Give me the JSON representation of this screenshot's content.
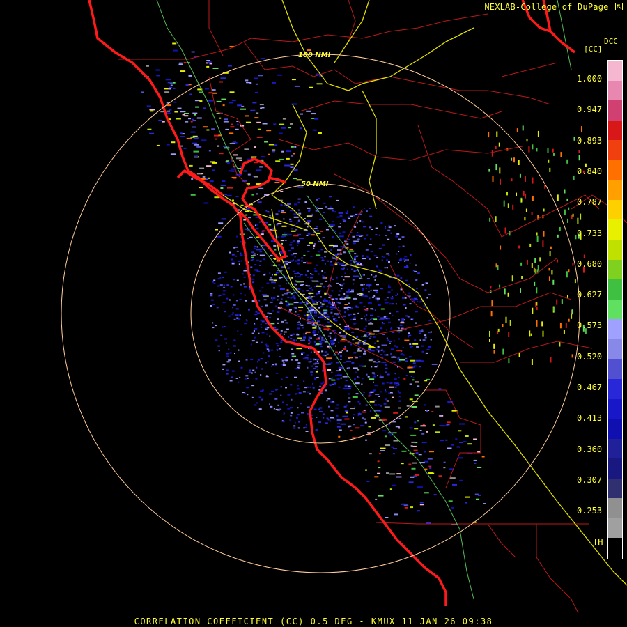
{
  "header": {
    "credit": "NEXLAB-College of DuPage",
    "credit_icon": "external-link-icon",
    "ddc_label": "DCC",
    "unit_label": "[CC]"
  },
  "range_rings": [
    {
      "label": "100 NMI"
    },
    {
      "label": "50 NMI"
    }
  ],
  "color_scale": {
    "ticks": [
      "1.000",
      "0.947",
      "0.893",
      "0.840",
      "0.787",
      "0.733",
      "0.680",
      "0.627",
      "0.573",
      "0.520",
      "0.467",
      "0.413",
      "0.360",
      "0.307",
      "0.253",
      "TH"
    ],
    "colors": [
      "#f5b6d0",
      "#e888b0",
      "#d04070",
      "#d81818",
      "#f04010",
      "#ff7000",
      "#ffa000",
      "#ffd000",
      "#e8f000",
      "#c0e000",
      "#80d020",
      "#40c040",
      "#60e060",
      "#a0a0ff",
      "#8888e8",
      "#5050d0",
      "#2828d8",
      "#1818c8",
      "#1010b0",
      "#202098",
      "#181880",
      "#303070",
      "#909090",
      "#a0a0a0",
      "#000000"
    ]
  },
  "footer": {
    "product": "CORRELATION COEFFICIENT (CC) 0.5 DEG - KMUX 11 JAN 26 09:38"
  },
  "colors": {
    "coast": "#ff1a1a",
    "county": "#cc2222",
    "highway": "#e6e600",
    "secondary_road": "#66cc66",
    "range_ring": "#ffcc99",
    "text": "#ffff33"
  }
}
